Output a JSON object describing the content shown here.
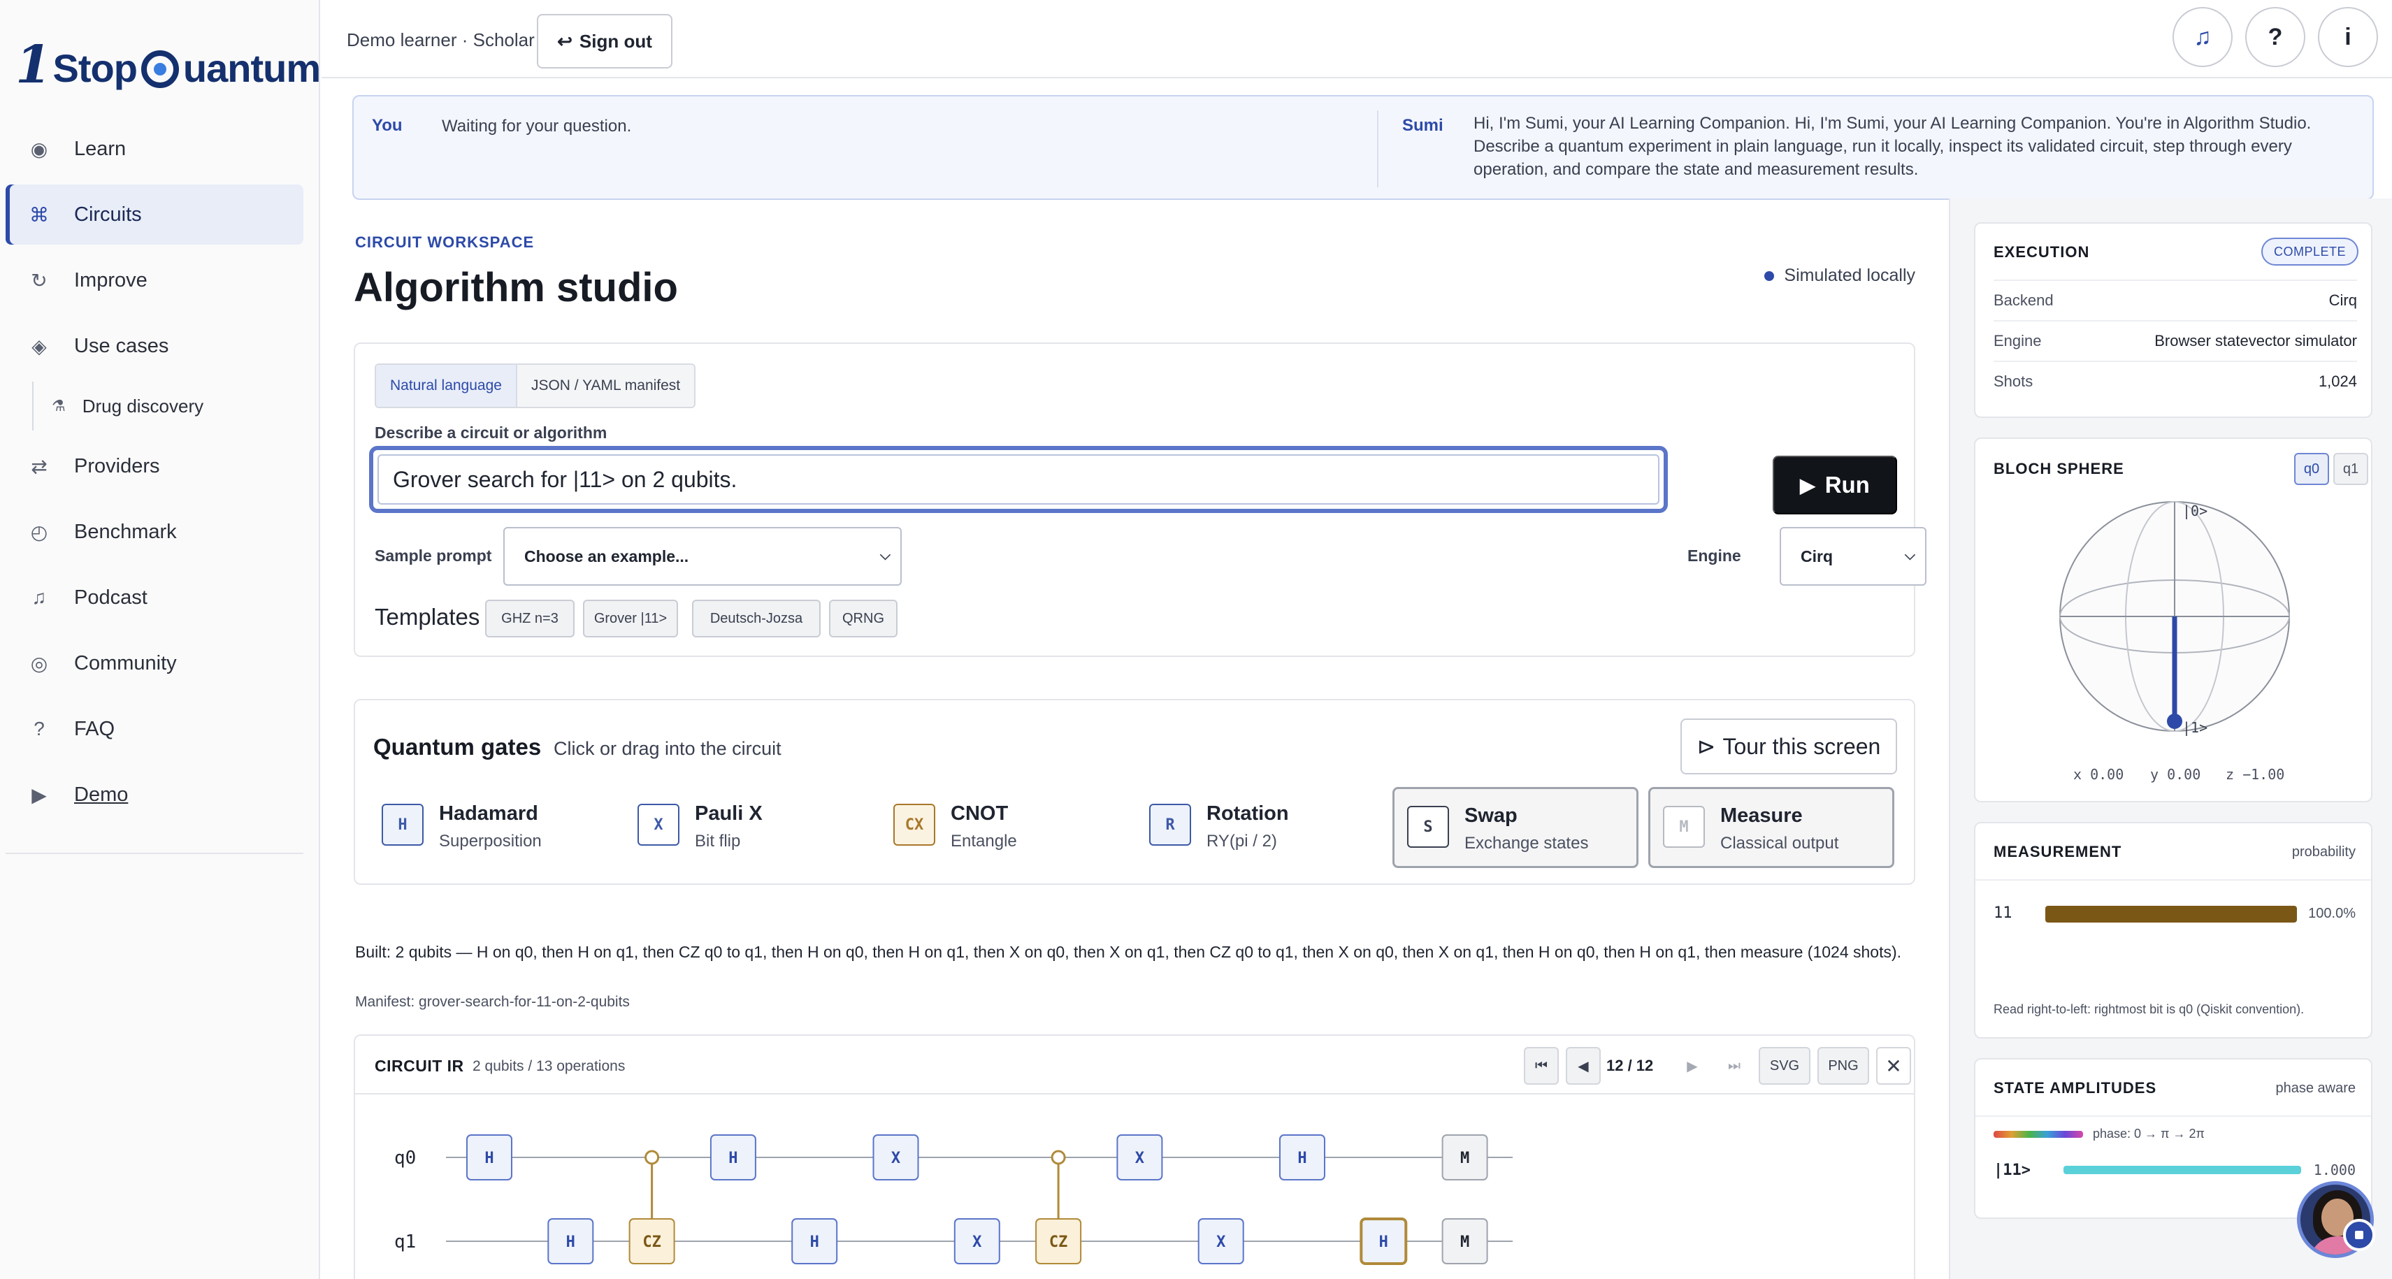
{
  "brand": {
    "one": "1",
    "stop": "Stop",
    "uantum": "uantum"
  },
  "sidebar": {
    "items": [
      {
        "label": "Learn",
        "icon": "◉"
      },
      {
        "label": "Circuits",
        "icon": "⌘"
      },
      {
        "label": "Improve",
        "icon": "↻"
      },
      {
        "label": "Use cases",
        "icon": "◈"
      },
      {
        "label": "Drug discovery",
        "icon": "⚗"
      },
      {
        "label": "Providers",
        "icon": "⇄"
      },
      {
        "label": "Benchmark",
        "icon": "◴"
      },
      {
        "label": "Podcast",
        "icon": "♫"
      },
      {
        "label": "Community",
        "icon": "◎"
      },
      {
        "label": "FAQ",
        "icon": "?"
      },
      {
        "label": "Demo",
        "icon": "▶"
      }
    ]
  },
  "topbar": {
    "user": "Demo learner · Scholar",
    "sign_out": "Sign out",
    "sign_out_icon": "↩",
    "music_icon": "♫",
    "help_icon": "?",
    "info_icon": "i"
  },
  "chat": {
    "you_label": "You",
    "you_text": "Waiting for your question.",
    "sumi_label": "Sumi",
    "sumi_text": "Hi, I'm Sumi, your AI Learning Companion. Hi, I'm Sumi, your AI Learning Companion. You're in Algorithm Studio. Describe a quantum experiment in plain language, run it locally, inspect its validated circuit, step through every operation, and compare the state and measurement results."
  },
  "workspace": {
    "eyebrow": "CIRCUIT WORKSPACE",
    "title": "Algorithm studio",
    "status": "Simulated locally"
  },
  "prompt": {
    "tabs": [
      "Natural language",
      "JSON / YAML manifest"
    ],
    "label": "Describe a circuit or algorithm",
    "value": "Grover search for |11> on 2 qubits.",
    "run": "Run",
    "run_icon": "▶",
    "sample_label": "Sample prompt",
    "sample_value": "Choose an example...",
    "engine_label": "Engine",
    "engine_value": "Cirq",
    "templates_label": "Templates",
    "templates": [
      "GHZ n=3",
      "Grover |11>",
      "Deutsch-Jozsa",
      "QRNG"
    ]
  },
  "gates": {
    "title": "Quantum gates",
    "subtitle": "Click or drag into the circuit",
    "tour": "Tour this screen",
    "tour_icon": "⊳",
    "items": [
      {
        "symbol": "H",
        "name": "Hadamard",
        "desc": "Superposition",
        "color": "#3d5aa8",
        "fill": "#eef2fa"
      },
      {
        "symbol": "X",
        "name": "Pauli X",
        "desc": "Bit flip",
        "color": "#3d5aa8",
        "fill": "#ffffff"
      },
      {
        "symbol": "CX",
        "name": "CNOT",
        "desc": "Entangle",
        "color": "#a8782a",
        "fill": "#fbf3e2"
      },
      {
        "symbol": "R",
        "name": "Rotation",
        "desc": "RY(pi / 2)",
        "color": "#3d5aa8",
        "fill": "#eef2fa"
      },
      {
        "symbol": "S",
        "name": "Swap",
        "desc": "Exchange states",
        "color": "#3a4050",
        "fill": "#ffffff"
      },
      {
        "symbol": "M",
        "name": "Measure",
        "desc": "Classical output",
        "color": "#b7bac2",
        "fill": "#ffffff"
      }
    ]
  },
  "built": {
    "text": "Built: 2 qubits — H on q0, then H on q1, then CZ q0 to q1, then H on q0, then H on q1, then X on q0, then X on q1, then CZ q0 to q1, then X on q0, then X on q1, then H on q0, then H on q1, then measure (1024 shots).",
    "manifest": "Manifest: grover-search-for-11-on-2-qubits"
  },
  "circuit_ir": {
    "title": "CIRCUIT IR",
    "subtitle": "2 qubits / 13 operations",
    "first_icon": "⏮",
    "prev_icon": "◀",
    "step": "12 / 12",
    "next_icon": "▶",
    "last_icon": "⏭",
    "svg": "SVG",
    "png": "PNG",
    "close_icon": "✕",
    "wires": [
      "q0",
      "q1"
    ],
    "ops": [
      {
        "col": 0,
        "q0": "H",
        "q1": ""
      },
      {
        "col": 1,
        "q0": "",
        "q1": "H"
      },
      {
        "col": 2,
        "q0": "•",
        "q1": "CZ"
      },
      {
        "col": 3,
        "q0": "H",
        "q1": ""
      },
      {
        "col": 4,
        "q0": "",
        "q1": "H"
      },
      {
        "col": 5,
        "q0": "X",
        "q1": ""
      },
      {
        "col": 6,
        "q0": "",
        "q1": "X"
      },
      {
        "col": 7,
        "q0": "•",
        "q1": "CZ"
      },
      {
        "col": 8,
        "q0": "X",
        "q1": ""
      },
      {
        "col": 9,
        "q0": "",
        "q1": "X"
      },
      {
        "col": 10,
        "q0": "H",
        "q1": ""
      },
      {
        "col": 11,
        "q0": "",
        "q1": "H"
      },
      {
        "col": 12,
        "q0": "M",
        "q1": "M"
      }
    ]
  },
  "execution": {
    "title": "EXECUTION",
    "badge": "COMPLETE",
    "rows": [
      {
        "k": "Backend",
        "v": "Cirq"
      },
      {
        "k": "Engine",
        "v": "Browser statevector simulator"
      },
      {
        "k": "Shots",
        "v": "1,024"
      }
    ]
  },
  "bloch": {
    "title": "BLOCH SPHERE",
    "qubits": [
      "q0",
      "q1"
    ],
    "top": "|0>",
    "bottom": "|1>",
    "x": "x 0.00",
    "y": "y 0.00",
    "z": "z −1.00"
  },
  "measurement": {
    "title": "MEASUREMENT",
    "mode": "probability",
    "outcome": "11",
    "probability": 1.0,
    "percent": "100.0%",
    "note": "Read right-to-left: rightmost bit is q0 (Qiskit convention)."
  },
  "amplitudes": {
    "title": "STATE AMPLITUDES",
    "mode": "phase aware",
    "phase_legend": "phase: 0 → π → 2π",
    "state": "|11>",
    "magnitude": 1.0,
    "value": "1.000"
  }
}
